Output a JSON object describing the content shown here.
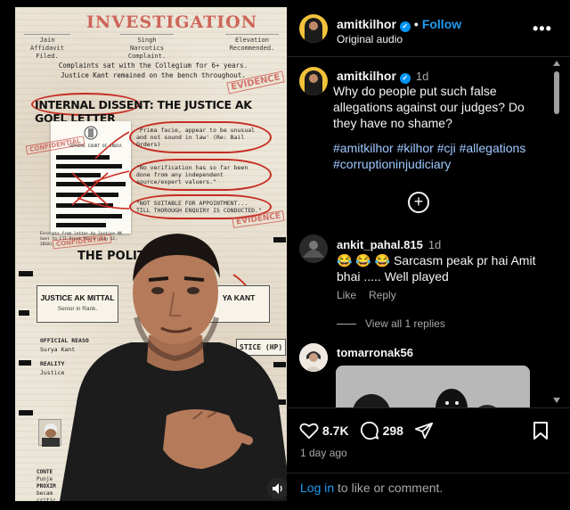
{
  "media": {
    "doc_title": "INVESTIGATION",
    "boxes": [
      "Jain Affidavit Filed.",
      "Singh Narcotics Complaint.",
      "Elevation Recommended."
    ],
    "complaint_line1": "Complaints sat with the Collegium for 6+ years.",
    "complaint_line2": "Justice Kant remained on the bench throughout.",
    "dissent_heading": "INTERNAL DISSENT: THE JUSTICE AK GOEL LETTER",
    "quote1": "'Prima facie, appear to be unusual and not sound in law' (Re: Bail Orders)",
    "quote2": "\"No verification has so far been done from any independent source/expert valuers.\"",
    "quote3": "\"NOT SUITABLE FOR APPOINTMENT... TILL THOROUGH ENQUIRY IS CONDUCTED.\"",
    "stamp_evidence": "EVIDENCE",
    "stamp_confidential": "CONFIDENTIAL",
    "politics_heading": "THE POLIT                 SION",
    "judge_name": "JUSTICE AK MITTAL",
    "judge_sub": "Senior in Rank.",
    "kant": "YA KANT",
    "official": "OFFICIAL REASO",
    "surya": "Surya Kant",
    "reality": "REALITY",
    "justice": "Justice",
    "hp": "STICE (HP)",
    "letter_court": "SUPREME COURT OF INDIA",
    "excerpt": "Excerpts from letter by Justice AK Goel to CJI Dipak Misra (Jan 12, 2018)."
  },
  "header": {
    "username": "amitkilhor",
    "follow": "Follow",
    "audio": "Original audio",
    "more": "•••"
  },
  "caption": {
    "username": "amitkilhor",
    "time": "1d",
    "text": "Why do people put such false allegations against our judges? Do they have no shame?",
    "hashtags": "#amitkilhor #kilhor #cji #allegations #corruptioninjudiciary"
  },
  "comments": [
    {
      "username": "ankit_pahal.815",
      "time": "1d",
      "text": "😂 😂 😂 Sarcasm peak pr hai Amit bhai ..... Well played",
      "like": "Like",
      "reply": "Reply",
      "view_replies": "View all 1 replies"
    },
    {
      "username": "tomarronak56"
    }
  ],
  "footer": {
    "likes": "8.7K",
    "comments_count": "298",
    "ago": "1 day ago",
    "login_link": "Log in",
    "login_rest": " to like or comment."
  },
  "colors": {
    "accent": "#1f9bf0",
    "stamp_red": "#c62c22",
    "avatar_yellow": "#f2c23a"
  }
}
